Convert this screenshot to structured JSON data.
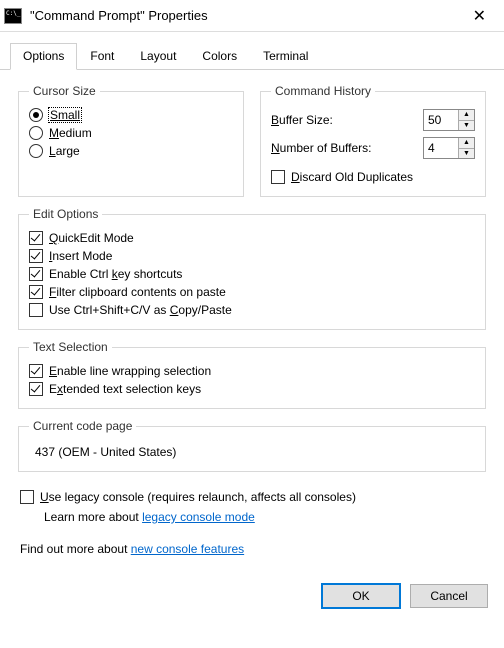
{
  "window": {
    "title": "\"Command Prompt\" Properties"
  },
  "tabs": {
    "options": "Options",
    "font": "Font",
    "layout": "Layout",
    "colors": "Colors",
    "terminal": "Terminal"
  },
  "cursor_size": {
    "legend": "Cursor Size",
    "small": "Small",
    "medium": "Medium",
    "large": "Large"
  },
  "command_history": {
    "legend": "Command History",
    "buffer_size_label_pre": "B",
    "buffer_size_label_post": "uffer Size:",
    "buffer_size_value": "50",
    "num_buffers_label_pre": "N",
    "num_buffers_label_post": "umber of Buffers:",
    "num_buffers_value": "4",
    "discard_pre": "D",
    "discard_post": "iscard Old Duplicates"
  },
  "edit_options": {
    "legend": "Edit Options",
    "quickedit_pre": "Q",
    "quickedit_post": "uickEdit Mode",
    "insert_pre": "I",
    "insert_post": "nsert Mode",
    "ctrlkey_pre": "Enable Ctrl ",
    "ctrlkey_u": "k",
    "ctrlkey_post": "ey shortcuts",
    "filter_pre": "F",
    "filter_post": "ilter clipboard contents on paste",
    "ctrlshift_pre": "Use Ctrl+Shift+C/V as ",
    "ctrlshift_u": "C",
    "ctrlshift_post": "opy/Paste"
  },
  "text_selection": {
    "legend": "Text Selection",
    "linewrap_pre": "E",
    "linewrap_post": "nable line wrapping selection",
    "extended_pre": "E",
    "extended_u": "x",
    "extended_post": "tended text selection keys"
  },
  "codepage": {
    "legend": "Current code page",
    "value": "437  (OEM - United States)"
  },
  "legacy": {
    "label_pre": "U",
    "label_post": "se legacy console (requires relaunch, affects all consoles)",
    "learn_pre": "Learn more about ",
    "learn_link": "legacy console mode"
  },
  "findout": {
    "pre": "Find out more about ",
    "link": "new console features"
  },
  "buttons": {
    "ok": "OK",
    "cancel": "Cancel"
  }
}
